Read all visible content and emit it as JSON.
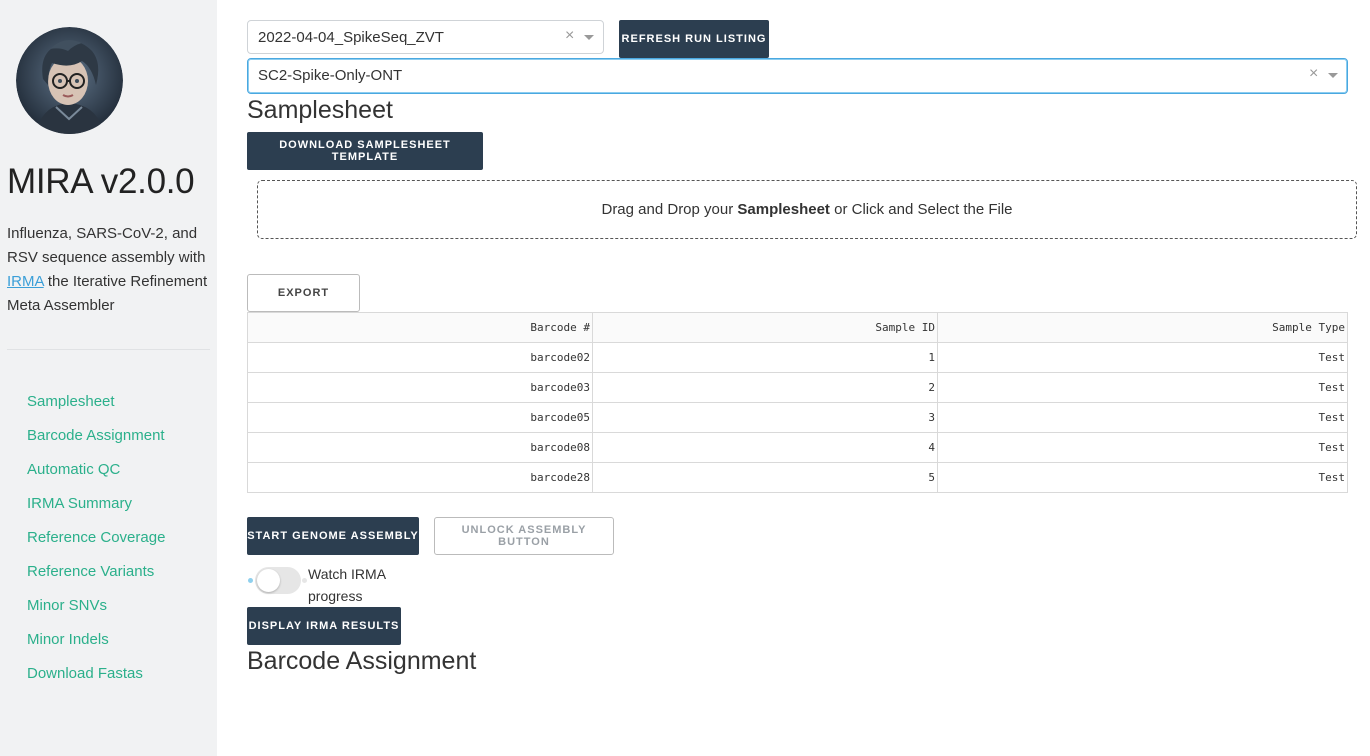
{
  "sidebar": {
    "title": "MIRA v2.0.0",
    "description_pre": "Influenza, SARS-CoV-2, and RSV sequence assembly with ",
    "description_link": "IRMA",
    "description_post": " the Iterative Refinement Meta Assembler",
    "nav": [
      {
        "label": "Samplesheet"
      },
      {
        "label": "Barcode Assignment"
      },
      {
        "label": "Automatic QC"
      },
      {
        "label": "IRMA Summary"
      },
      {
        "label": "Reference Coverage"
      },
      {
        "label": "Reference Variants"
      },
      {
        "label": "Minor SNVs"
      },
      {
        "label": "Minor Indels"
      },
      {
        "label": "Download Fastas"
      }
    ]
  },
  "run_select": {
    "value": "2022-04-04_SpikeSeq_ZVT",
    "clear": "×"
  },
  "refresh_button": "REFRESH RUN LISTING",
  "experiment_select": {
    "value": "SC2-Spike-Only-ONT",
    "clear": "×"
  },
  "samplesheet": {
    "heading": "Samplesheet",
    "download_template_button": "DOWNLOAD SAMPLESHEET TEMPLATE",
    "dropzone_pre": "Drag and Drop your ",
    "dropzone_bold": "Samplesheet",
    "dropzone_post": " or Click and Select the File",
    "export_button": "EXPORT",
    "columns": [
      "Barcode #",
      "Sample ID",
      "Sample Type"
    ],
    "rows": [
      [
        "barcode02",
        "1",
        "Test"
      ],
      [
        "barcode03",
        "2",
        "Test"
      ],
      [
        "barcode05",
        "3",
        "Test"
      ],
      [
        "barcode08",
        "4",
        "Test"
      ],
      [
        "barcode28",
        "5",
        "Test"
      ]
    ]
  },
  "assembly": {
    "start_button": "START GENOME ASSEMBLY",
    "unlock_button": "UNLOCK ASSEMBLY BUTTON",
    "watch_label": "Watch IRMA progress",
    "watch_enabled": false,
    "display_results_button": "DISPLAY IRMA RESULTS"
  },
  "barcode_assignment": {
    "heading": "Barcode Assignment"
  },
  "colors": {
    "sidebar_bg": "#f1f2f3",
    "nav_link": "#2bb08b",
    "dark_button": "#2c3e50",
    "link": "#3b9fd8",
    "focus_border": "#4aa8e0"
  }
}
